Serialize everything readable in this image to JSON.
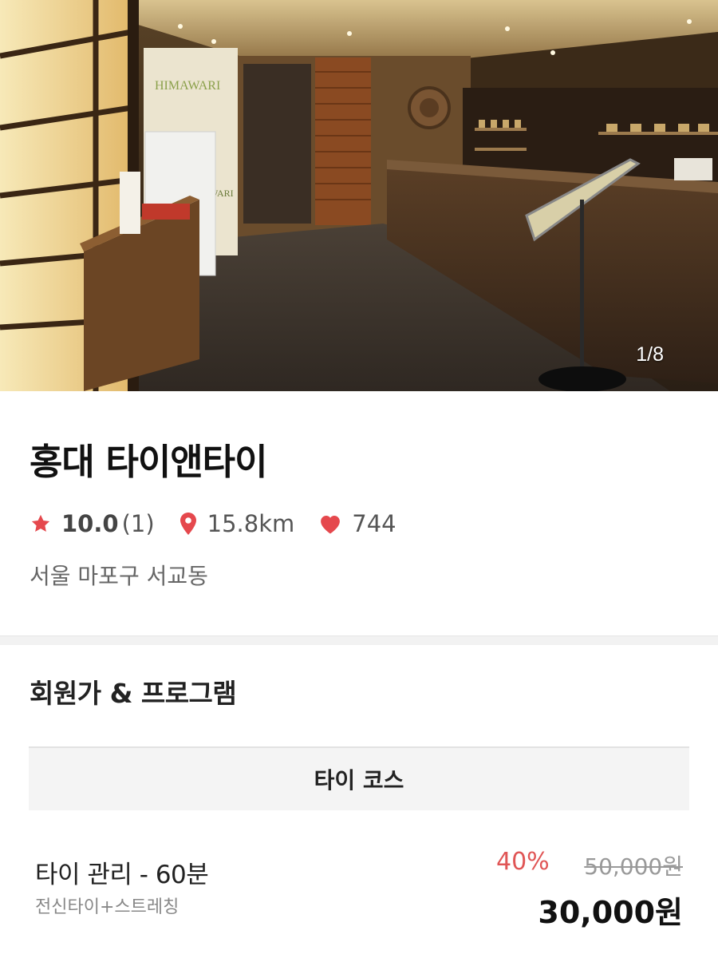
{
  "gallery": {
    "counter": "1/8",
    "sign_text": "HIMAWARI",
    "sign_text_lower": "WARI"
  },
  "shop": {
    "name": "홍대 타이앤타이",
    "rating": "10.0",
    "review_count": "(1)",
    "distance": "15.8km",
    "likes": "744",
    "address": "서울 마포구 서교동"
  },
  "icons": {
    "rating": "star-icon",
    "distance": "location-pin-icon",
    "likes": "heart-icon"
  },
  "colors": {
    "accent": "#e5484d",
    "discount": "#e05555"
  },
  "programs": {
    "section_title": "회원가 & 프로그램",
    "course_tab": "타이 코스",
    "items": [
      {
        "name": "타이 관리 - 60분",
        "description": "전신타이+스트레칭",
        "discount": "40%",
        "original_price": "50,000원",
        "price": "30,000원"
      }
    ]
  }
}
